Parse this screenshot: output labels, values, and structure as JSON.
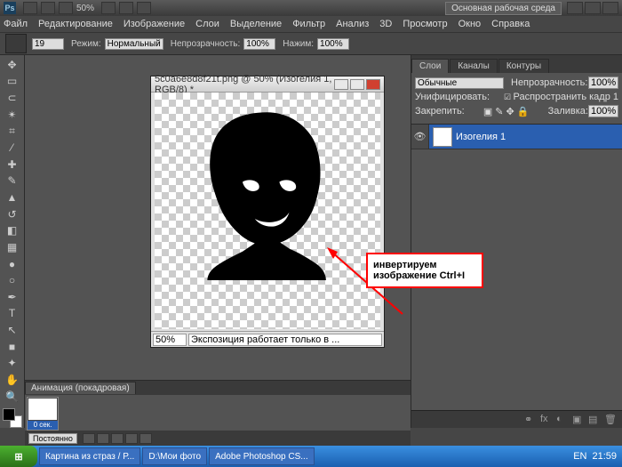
{
  "titlebar": {
    "zoom": "50%",
    "workspace": "Основная рабочая среда"
  },
  "menu": {
    "file": "Файл",
    "edit": "Редактирование",
    "image": "Изображение",
    "layers": "Слои",
    "select": "Выделение",
    "filter": "Фильтр",
    "analysis": "Анализ",
    "threed": "3D",
    "view": "Просмотр",
    "window": "Окно",
    "help": "Справка"
  },
  "options": {
    "brush_size": "19",
    "mode_label": "Режим:",
    "mode_value": "Нормальный",
    "opacity_label": "Непрозрачность:",
    "opacity_value": "100%",
    "flow_label": "Нажим:",
    "flow_value": "100%"
  },
  "document": {
    "title": "5c0a6e8d8f21t.png @ 50% (Изогелия 1, RGB/8) *",
    "zoom": "50%",
    "status": "Экспозиция работает только в ..."
  },
  "annotation": {
    "text": "инвертируем изображение Ctrl+I"
  },
  "layers_panel": {
    "tab1": "Слои",
    "tab2": "Каналы",
    "tab3": "Контуры",
    "blend": "Обычные",
    "opacity_label": "Непрозрачность:",
    "opacity": "100%",
    "unify_label": "Унифицировать:",
    "propagate": "Распространить кадр 1",
    "lock_label": "Закрепить:",
    "fill_label": "Заливка:",
    "fill": "100%",
    "layer_name": "Изогелия 1"
  },
  "animation": {
    "title": "Анимация (покадровая)",
    "frame_duration": "0 сек.",
    "loop": "Постоянно"
  },
  "taskbar": {
    "item1": "Картина из страз / Р...",
    "item2": "D:\\Мои фото",
    "item3": "Adobe Photoshop CS...",
    "lang": "EN",
    "time": "21:59"
  }
}
